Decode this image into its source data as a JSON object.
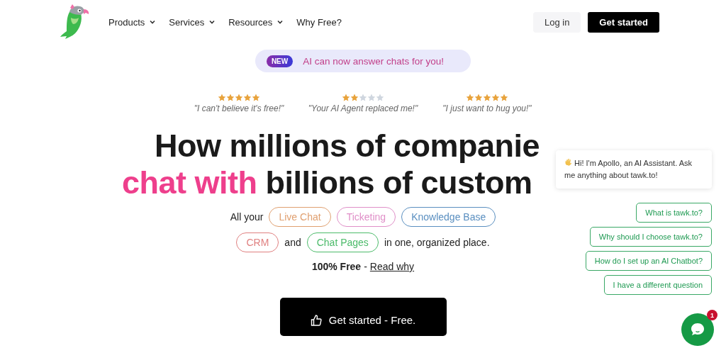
{
  "nav": {
    "items": [
      {
        "label": "Products",
        "dropdown": true
      },
      {
        "label": "Services",
        "dropdown": true
      },
      {
        "label": "Resources",
        "dropdown": true
      },
      {
        "label": "Why Free?",
        "dropdown": false
      }
    ],
    "login": "Log in",
    "cta": "Get started"
  },
  "announcement": {
    "badge": "NEW",
    "text": "AI can now answer chats for you!"
  },
  "reviews": [
    {
      "stars": 5,
      "quote": "\"I can't believe it's free!\""
    },
    {
      "stars": 2,
      "quote": "\"Your AI Agent replaced me!\""
    },
    {
      "stars": 5,
      "quote": "\"I just want to hug you!\""
    }
  ],
  "headline": {
    "line_1": "How millions of companie",
    "line_2_accent": "chat with",
    "line_2_rest": "billions of custom"
  },
  "products": {
    "intro": "All your",
    "joiner": "and",
    "outro": "in one, organized place.",
    "tags": [
      {
        "label": "Live Chat",
        "color": "#e0a070"
      },
      {
        "label": "Ticketing",
        "color": "#e08fc8"
      },
      {
        "label": "Knowledge Base",
        "color": "#5a8fc0"
      },
      {
        "label": "CRM",
        "color": "#e08080"
      },
      {
        "label": "Chat Pages",
        "color": "#4cbb6a"
      }
    ]
  },
  "free_note": {
    "bold": "100% Free",
    "separator": "-",
    "link": "Read why"
  },
  "main_cta": "Get started - Free.",
  "chat_widget": {
    "greeting": "Hi! I'm Apollo, an AI Assistant. Ask me anything about tawk.to!",
    "quick_replies": [
      "What is tawk.to?",
      "Why should I choose tawk.to?",
      "How do I set up an AI Chatbot?",
      "I have a different question"
    ],
    "unread": "1"
  }
}
